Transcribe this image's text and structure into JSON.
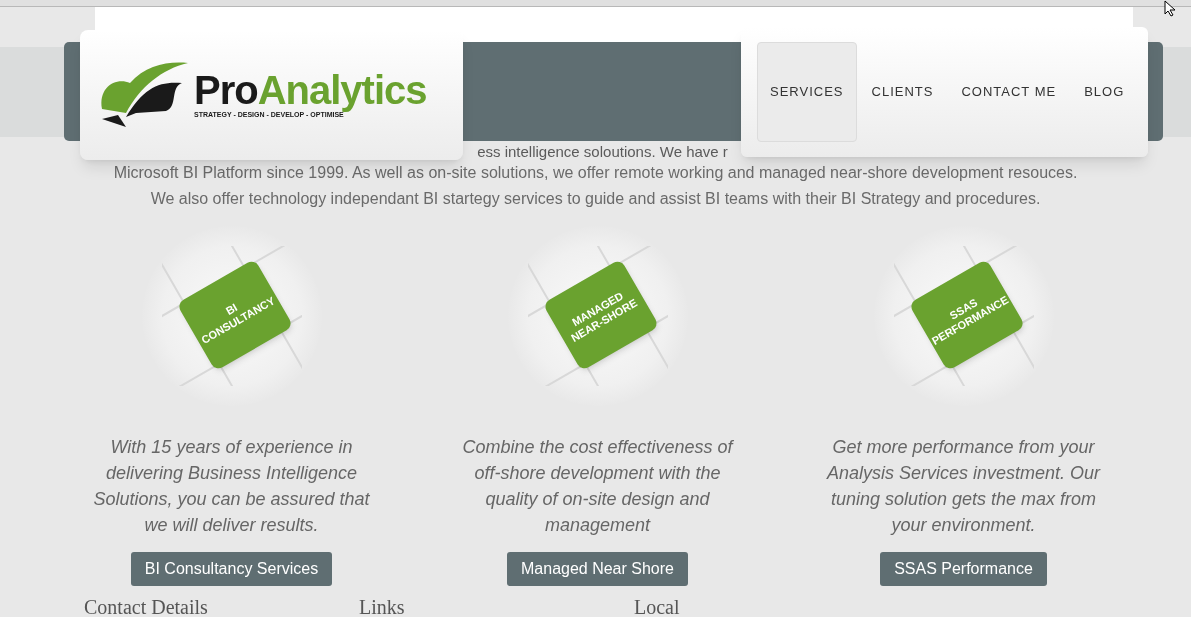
{
  "logo": {
    "name_dark": "Pro",
    "name_green": "Analytics",
    "tagline": "STRATEGY - DESIGN - DEVELOP - OPTIMISE"
  },
  "nav": [
    {
      "label": "SERVICES",
      "selected": true
    },
    {
      "label": "CLIENTS",
      "selected": false
    },
    {
      "label": "CONTACT ME",
      "selected": false
    },
    {
      "label": "BLOG",
      "selected": false
    }
  ],
  "intro": [
    "ess intelligence soloutions. We have r",
    "Microsoft BI Platform since 1999. As well as on-site solutions, we offer remote working and managed near-shore development resouces.",
    "We also offer technology independant BI startegy services to guide and assist BI teams with their BI Strategy and procedures."
  ],
  "services": [
    {
      "piece": "BI CONSULTANCY",
      "text": "With 15 years of experience in delivering Business Intelligence Solutions, you can be assured that we will deliver results.",
      "button": "BI Consultancy Services"
    },
    {
      "piece": "MANAGED NEAR-SHORE",
      "text": "Combine the cost effectiveness of off-shore development with the quality of on-site design and management",
      "button": "Managed Near Shore"
    },
    {
      "piece": "SSAS PERFORMANCE",
      "text": "Get more performance from your Analysis Services investment. Our tuning solution gets the max from your environment.",
      "button": "SSAS Performance"
    }
  ],
  "footer_headings": [
    "Contact Details",
    "Links",
    "Local"
  ]
}
